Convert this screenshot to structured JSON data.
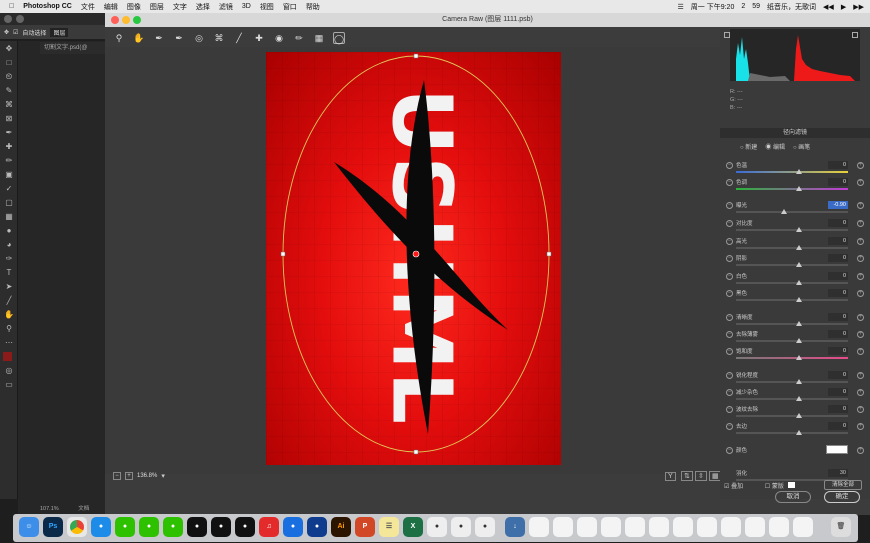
{
  "menubar": {
    "app": "Photoshop CC",
    "items": [
      "文件",
      "编辑",
      "图像",
      "图层",
      "文字",
      "选择",
      "滤镜",
      "3D",
      "视图",
      "窗口",
      "帮助"
    ],
    "clock": "周一 下午9:20",
    "badge": "2",
    "battery": "59",
    "user": "纸音乐，无歌词"
  },
  "ps": {
    "autoselect": "自动选择",
    "layer": "图层",
    "tab": "切割文字.psd(@",
    "zoom": "107.1%",
    "doc": "文档"
  },
  "cr": {
    "title": "Camera Raw (图层 1111.psb)",
    "zoom": "136.8%",
    "panel_title": "径向滤镜",
    "modes": [
      "新建",
      "编辑",
      "画笔"
    ],
    "rgb": [
      "R:",
      "G:",
      "B:"
    ],
    "rgb_vals": [
      "---",
      "---",
      "---"
    ],
    "adjust": [
      {
        "label": "色温",
        "value": "0"
      },
      {
        "label": "色调",
        "value": "0"
      },
      {
        "label": "曝光",
        "value": "-0.90"
      },
      {
        "label": "对比度",
        "value": "0"
      },
      {
        "label": "高光",
        "value": "0"
      },
      {
        "label": "阴影",
        "value": "0"
      },
      {
        "label": "白色",
        "value": "0"
      },
      {
        "label": "黑色",
        "value": "0"
      },
      {
        "label": "清晰度",
        "value": "0"
      },
      {
        "label": "去除薄雾",
        "value": "0"
      },
      {
        "label": "饱和度",
        "value": "0"
      },
      {
        "label": "锐化程度",
        "value": "0"
      },
      {
        "label": "减少杂色",
        "value": "0"
      },
      {
        "label": "波纹去除",
        "value": "0"
      },
      {
        "label": "去边",
        "value": "0"
      },
      {
        "label": "颜色",
        "value": ""
      }
    ],
    "feather_label": "羽化",
    "feather": "30",
    "overlay": "叠加",
    "mask": "蒙版",
    "clear_all": "清除全部",
    "cancel": "取消",
    "ok": "确定",
    "poster_text": "USHML"
  },
  "colors": {
    "accent": "#3a6cc7",
    "poster_red": "#e30d0d"
  }
}
